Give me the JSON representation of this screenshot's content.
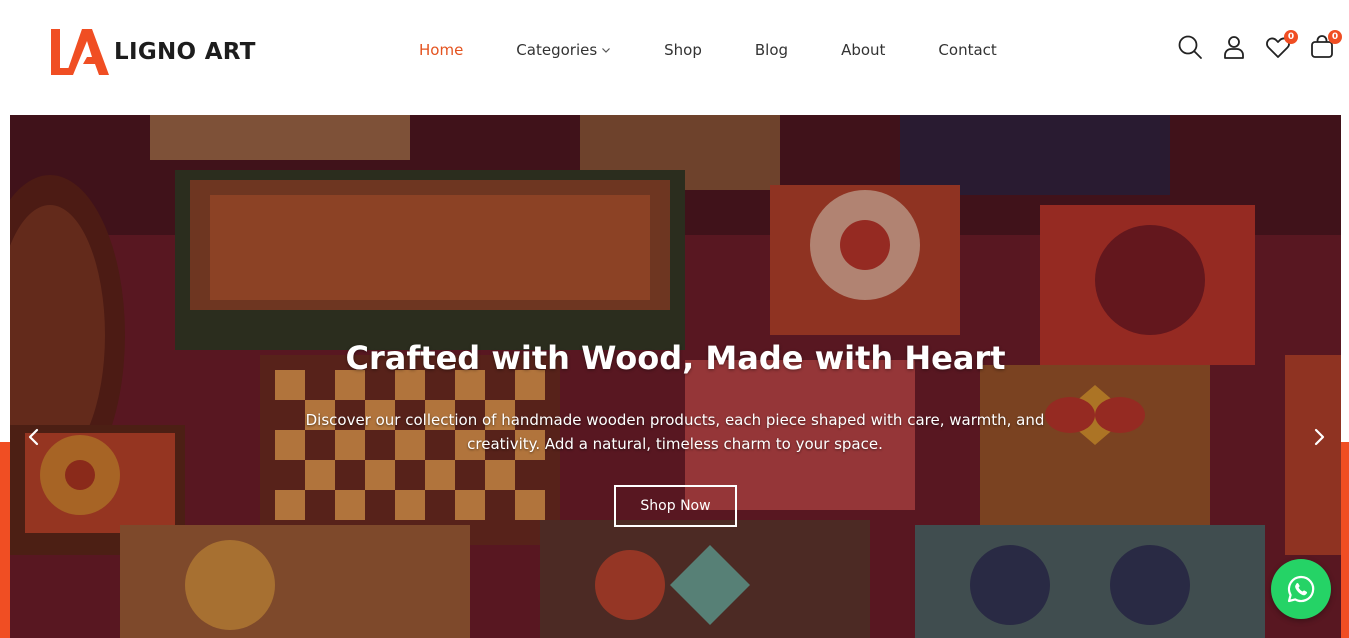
{
  "brand": {
    "logo_text": "LIGNO ART",
    "accent_color": "#f04e23"
  },
  "nav": {
    "items": [
      {
        "label": "Home",
        "active": true
      },
      {
        "label": "Categories",
        "has_dropdown": true
      },
      {
        "label": "Shop"
      },
      {
        "label": "Blog"
      },
      {
        "label": "About"
      },
      {
        "label": "Contact"
      }
    ]
  },
  "header_icons": {
    "search": "search-icon",
    "account": "user-icon",
    "wishlist": {
      "icon": "heart-icon",
      "count": "0"
    },
    "cart": {
      "icon": "cart-icon",
      "count": "0"
    }
  },
  "hero": {
    "title": "Crafted with Wood, Made with Heart",
    "subtitle": "Discover our collection of handmade wooden products, each piece shaped with care, warmth, and creativity. Add a natural, timeless charm to your space.",
    "cta_label": "Shop Now",
    "prev_icon": "chevron-left-icon",
    "next_icon": "chevron-right-icon"
  },
  "floating": {
    "whatsapp_icon": "whatsapp-icon",
    "color": "#25d366"
  }
}
